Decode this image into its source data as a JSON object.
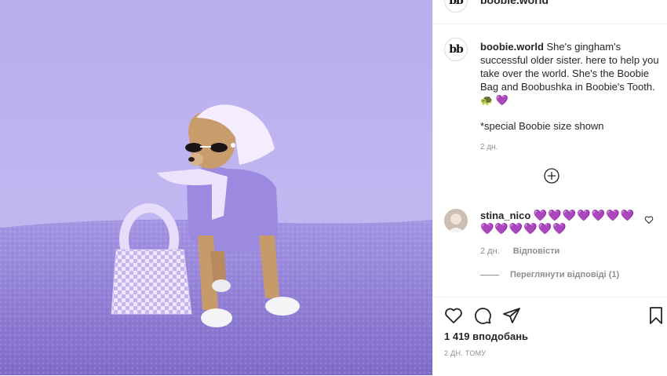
{
  "post": {
    "username": "boobie.world",
    "avatar_text": "bb",
    "caption": "She's gingham's successful older sister. here to help you take over the world. She's the Boobie Bag and Boobushka in Boobie's Tooth.",
    "caption_emojis": "💜",
    "caption_note": "*special Boobie size shown",
    "caption_time": "2 дн."
  },
  "comment": {
    "username": "stina_nico",
    "hearts_line1": "💜💜💜💜💜💜💜",
    "hearts_line2": "💜💜💜💜💜💜",
    "time": "2 дн.",
    "reply_label": "Відповісти",
    "view_replies_label": "Переглянути відповіді (1)"
  },
  "footer": {
    "likes": "1 419 вподобань",
    "date": "2 ДН. ТОМУ"
  },
  "colors": {
    "heart_purple": "#7d4fd6",
    "background_lavender": "#b3a7e6",
    "carpet_purple": "#8f7ed6"
  }
}
